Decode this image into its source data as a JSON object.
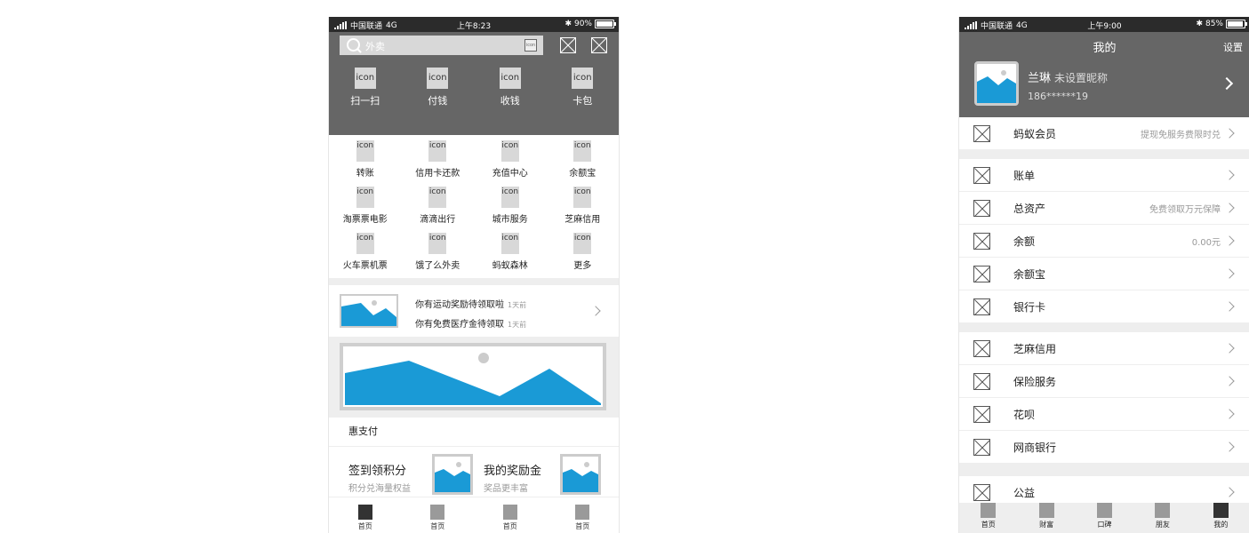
{
  "phone1": {
    "status": {
      "carrier": "中国联通",
      "network": "4G",
      "time": "上午8:23",
      "battery": "90%",
      "battery_level": 0.9
    },
    "search": {
      "placeholder": "外卖",
      "scan_icon_text": "icon"
    },
    "quick": [
      {
        "icon": "icon",
        "label": "扫一扫"
      },
      {
        "icon": "icon",
        "label": "付钱"
      },
      {
        "icon": "icon",
        "label": "收钱"
      },
      {
        "icon": "icon",
        "label": "卡包"
      }
    ],
    "grid": [
      {
        "icon": "icon",
        "label": "转账"
      },
      {
        "icon": "icon",
        "label": "信用卡还款"
      },
      {
        "icon": "icon",
        "label": "充值中心"
      },
      {
        "icon": "icon",
        "label": "余额宝"
      },
      {
        "icon": "icon",
        "label": "淘票票电影"
      },
      {
        "icon": "icon",
        "label": "滴滴出行"
      },
      {
        "icon": "icon",
        "label": "城市服务"
      },
      {
        "icon": "icon",
        "label": "芝麻信用"
      },
      {
        "icon": "icon",
        "label": "火车票机票"
      },
      {
        "icon": "icon",
        "label": "饿了么外卖"
      },
      {
        "icon": "icon",
        "label": "蚂蚁森林"
      },
      {
        "icon": "icon",
        "label": "更多"
      }
    ],
    "notices": [
      {
        "text": "你有运动奖励待领取啦",
        "time": "1天前"
      },
      {
        "text": "你有免费医疗金待领取",
        "time": "1天前"
      }
    ],
    "section_title": "惠支付",
    "cards": [
      {
        "title": "签到领积分",
        "subtitle": "积分兑海量权益"
      },
      {
        "title": "我的奖励金",
        "subtitle": "奖品更丰富"
      }
    ],
    "tabs": [
      "首页",
      "首页",
      "首页",
      "首页"
    ]
  },
  "phone2": {
    "status": {
      "carrier": "中国联通",
      "network": "4G",
      "time": "上午9:00",
      "battery": "85%",
      "battery_level": 0.85
    },
    "header": {
      "title": "我的",
      "settings": "设置",
      "name": "兰琳",
      "nickname": "未设置昵称",
      "phone": "186******19"
    },
    "rows": [
      {
        "label": "蚂蚁会员",
        "right": "提现免服务费限时兑"
      },
      {
        "label": "账单",
        "right": ""
      },
      {
        "label": "总资产",
        "right": "免费领取万元保障"
      },
      {
        "label": "余额",
        "right": "0.00元"
      },
      {
        "label": "余额宝",
        "right": ""
      },
      {
        "label": "银行卡",
        "right": ""
      },
      {
        "label": "芝麻信用",
        "right": ""
      },
      {
        "label": "保险服务",
        "right": ""
      },
      {
        "label": "花呗",
        "right": ""
      },
      {
        "label": "网商银行",
        "right": ""
      },
      {
        "label": "公益",
        "right": ""
      }
    ],
    "tabs": [
      "首页",
      "财富",
      "口碑",
      "朋友",
      "我的"
    ]
  },
  "colors": {
    "image_blue": "#1a9ad6",
    "header_gray": "#666666",
    "status_dark": "#2b2b2b"
  }
}
